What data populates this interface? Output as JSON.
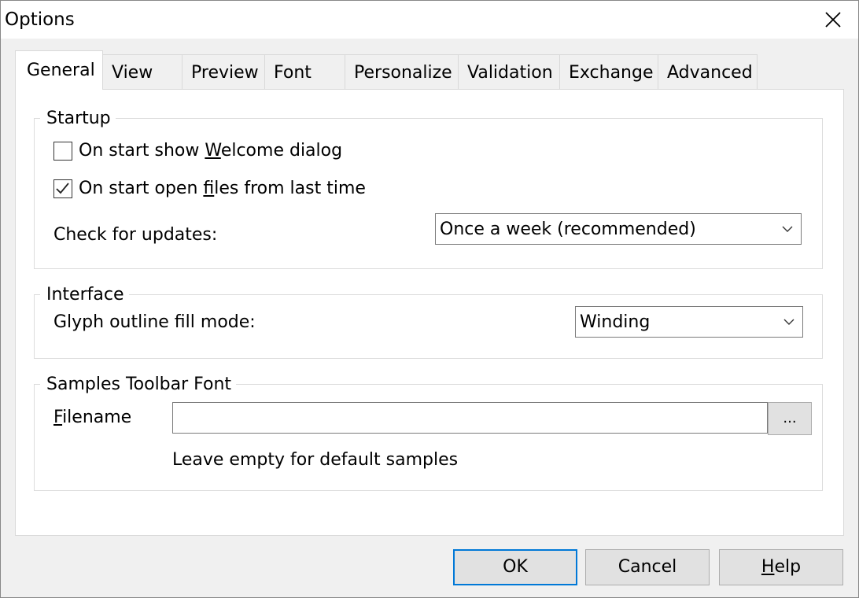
{
  "window": {
    "title": "Options"
  },
  "tabs": [
    {
      "label": "General"
    },
    {
      "label": "View"
    },
    {
      "label": "Preview"
    },
    {
      "label": "Font"
    },
    {
      "label": "Personalize"
    },
    {
      "label": "Validation"
    },
    {
      "label": "Exchange"
    },
    {
      "label": "Advanced"
    }
  ],
  "startup": {
    "title": "Startup",
    "welcome": {
      "pre": "On start show ",
      "accel": "W",
      "post": "elcome dialog",
      "checked": false
    },
    "open_files": {
      "pre": "On start open ",
      "accel": "f",
      "post": "iles from last time",
      "checked": true
    },
    "updates_label": "Check for updates:",
    "updates_value": "Once a week (recommended)"
  },
  "interface": {
    "title": "Interface",
    "fill_mode_label": "Glyph outline fill mode:",
    "fill_mode_value": "Winding"
  },
  "samples": {
    "title": "Samples Toolbar Font",
    "filename_accel": "F",
    "filename_rest": "ilename",
    "filename_value": "",
    "browse_label": "...",
    "hint": "Leave empty for default samples"
  },
  "buttons": {
    "ok": "OK",
    "cancel": "Cancel",
    "help_accel": "H",
    "help_rest": "elp"
  },
  "icons": {
    "close": "close-icon",
    "check": "checkmark-icon",
    "dropdown": "chevron-down-icon"
  }
}
